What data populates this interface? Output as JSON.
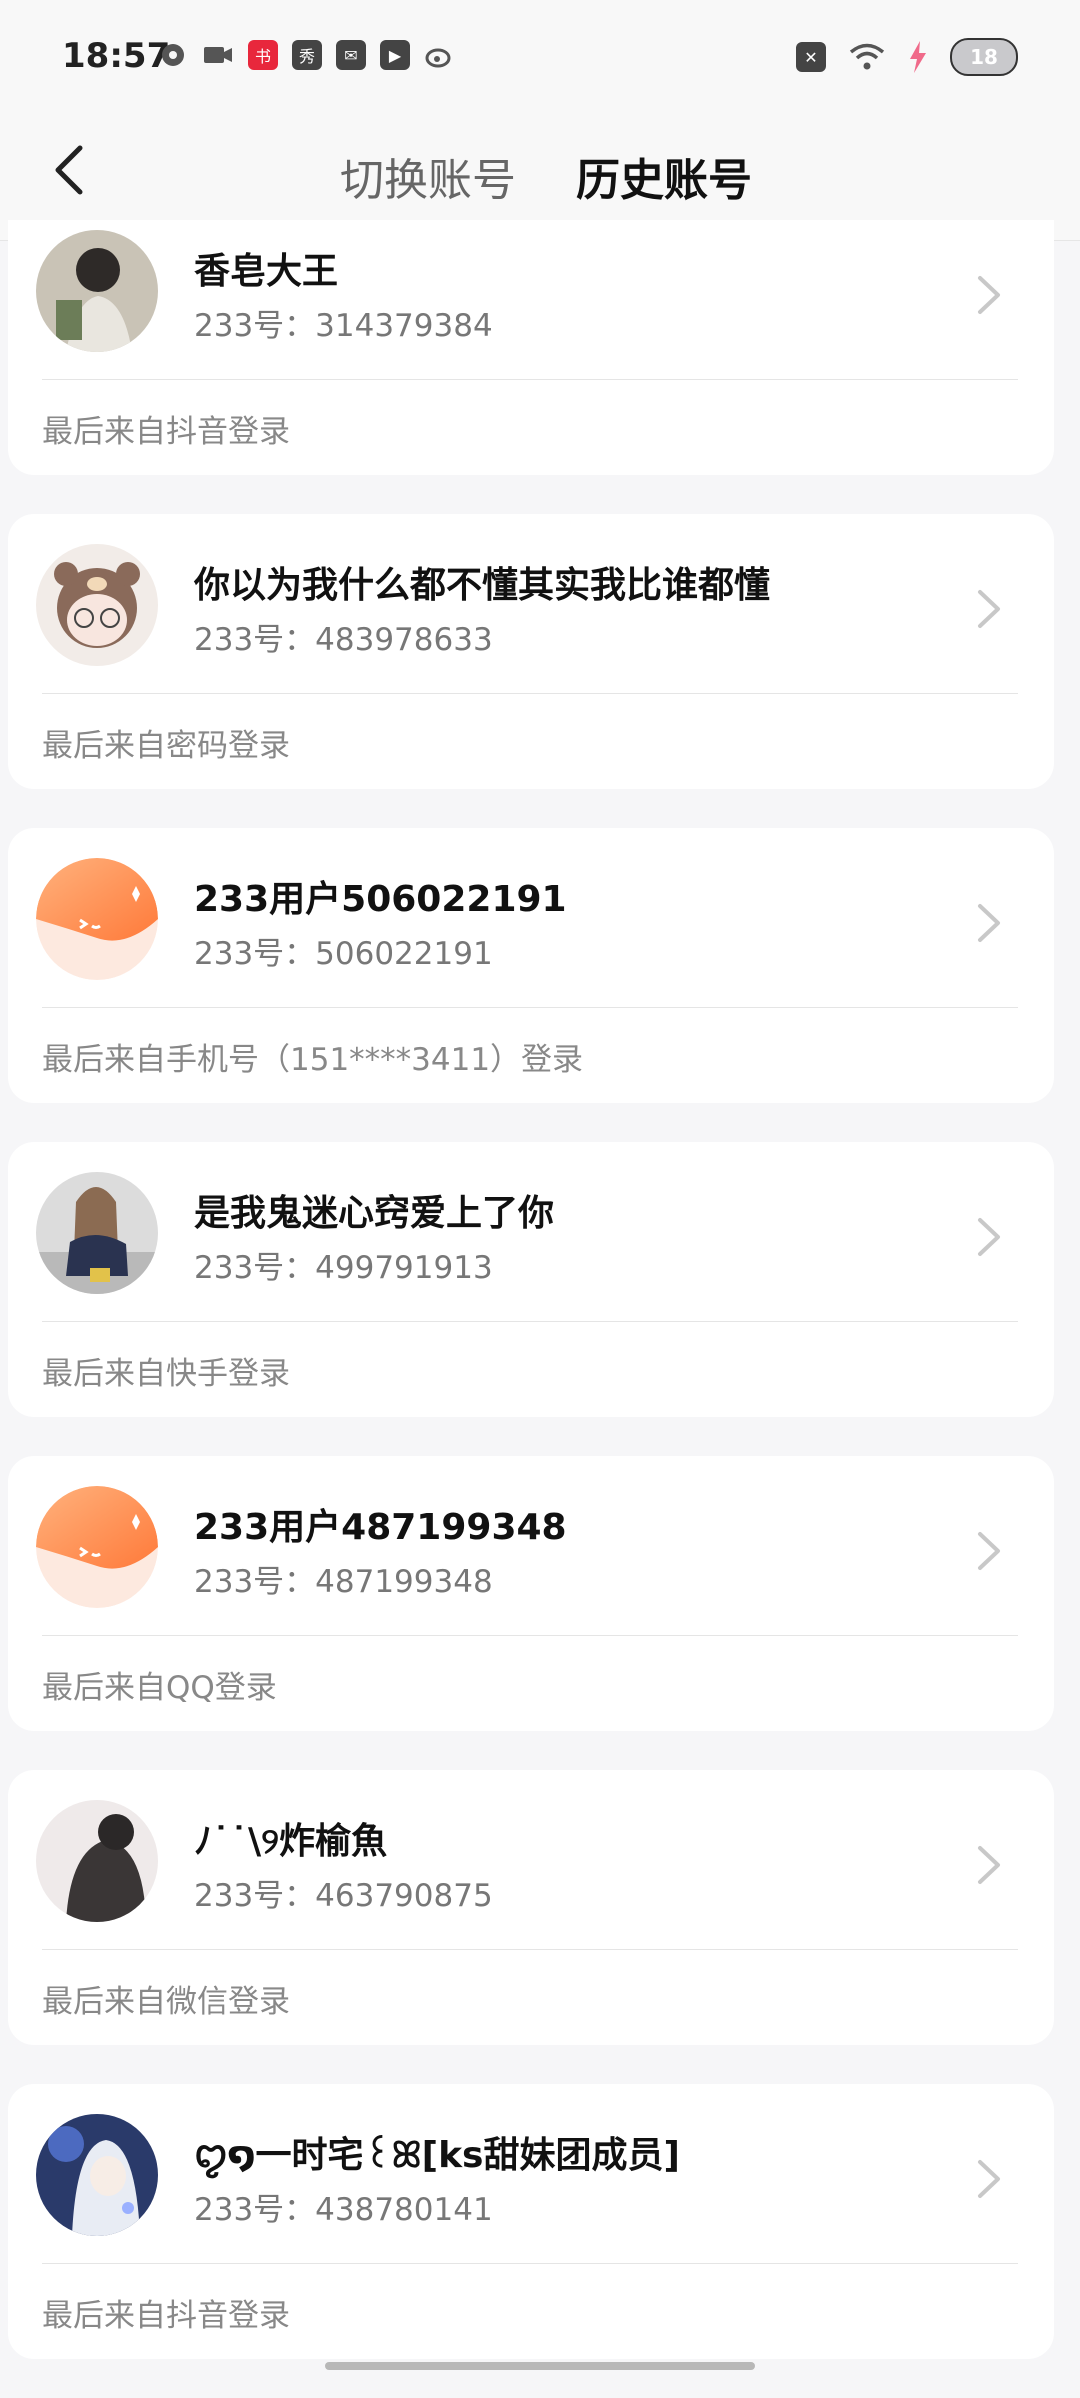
{
  "status_bar": {
    "time": "18:57",
    "battery": "18"
  },
  "header": {
    "tabs": [
      {
        "label": "切换账号",
        "active": false
      },
      {
        "label": "历史账号",
        "active": true
      }
    ],
    "accent_color": "#ff6a1a"
  },
  "accounts": [
    {
      "name": "香皂大王",
      "number": "233号：314379384",
      "source": "最后来自抖音登录",
      "avatar_icon": "photo-avatar-girl"
    },
    {
      "name": "你以为我什么都不懂其实我比谁都懂",
      "number": "233号：483978633",
      "source": "最后来自密码登录",
      "avatar_icon": "bear-girl-avatar"
    },
    {
      "name": "233用户506022191",
      "number": "233号：506022191",
      "source": "最后来自手机号（151****3411）登录",
      "avatar_icon": "default-orange-avatar"
    },
    {
      "name": "是我鬼迷心窍爱上了你",
      "number": "233号：499791913",
      "source": "最后来自快手登录",
      "avatar_icon": "photo-avatar-girl-sitting"
    },
    {
      "name": "233用户487199348",
      "number": "233号：487199348",
      "source": "最后来自QQ登录",
      "avatar_icon": "default-orange-avatar"
    },
    {
      "name": "ﾉ˙˙\\୨炸榆魚",
      "number": "233号：463790875",
      "source": "最后来自微信登录",
      "avatar_icon": "photo-avatar-hoodie"
    },
    {
      "name": "ꨄ໑一时宅꒰ꕤ[ks甜妹团成员]",
      "number": "233号：438780141",
      "source": "最后来自抖音登录",
      "avatar_icon": "anime-avatar"
    }
  ]
}
